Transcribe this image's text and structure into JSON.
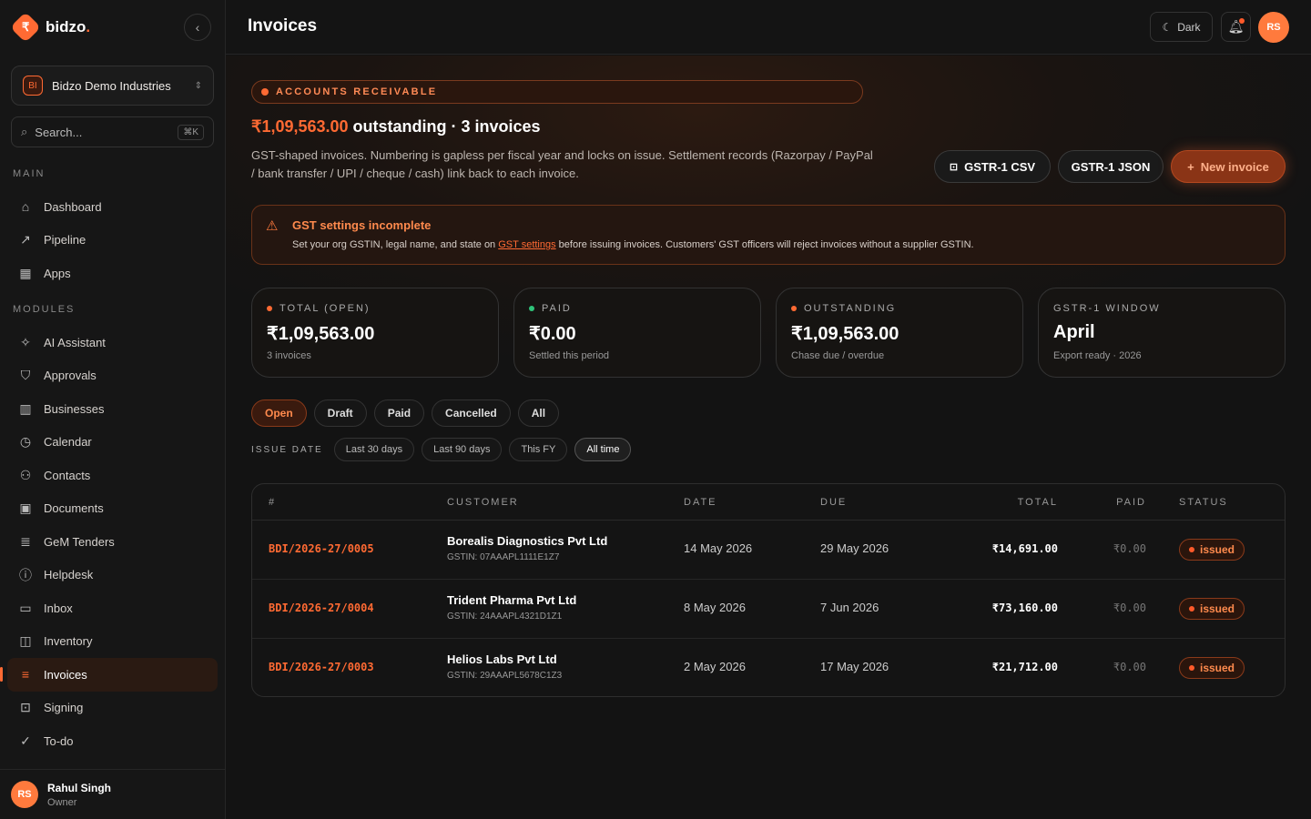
{
  "brand": {
    "name": "bidzo",
    "dot": ".",
    "logo_glyph": "₹"
  },
  "org": {
    "badge": "BI",
    "name": "Bidzo Demo Industries"
  },
  "search": {
    "placeholder": "Search...",
    "shortcut": "⌘K"
  },
  "sidebar": {
    "main_label": "MAIN",
    "main_items": [
      {
        "label": "Dashboard",
        "icon": "home-icon",
        "glyph": "⌂"
      },
      {
        "label": "Pipeline",
        "icon": "trending-icon",
        "glyph": "↗"
      },
      {
        "label": "Apps",
        "icon": "grid-icon",
        "glyph": "▦"
      }
    ],
    "modules_label": "MODULES",
    "module_items": [
      {
        "label": "AI Assistant",
        "icon": "sparkle-icon",
        "glyph": "✧"
      },
      {
        "label": "Approvals",
        "icon": "shield-check-icon",
        "glyph": "⛉"
      },
      {
        "label": "Businesses",
        "icon": "building-icon",
        "glyph": "▥"
      },
      {
        "label": "Calendar",
        "icon": "clock-icon",
        "glyph": "◷"
      },
      {
        "label": "Contacts",
        "icon": "users-icon",
        "glyph": "⚇"
      },
      {
        "label": "Documents",
        "icon": "document-icon",
        "glyph": "▣"
      },
      {
        "label": "GeM Tenders",
        "icon": "list-icon",
        "glyph": "≣"
      },
      {
        "label": "Helpdesk",
        "icon": "info-icon",
        "glyph": "ⓘ"
      },
      {
        "label": "Inbox",
        "icon": "inbox-icon",
        "glyph": "▭"
      },
      {
        "label": "Inventory",
        "icon": "box-icon",
        "glyph": "◫"
      },
      {
        "label": "Invoices",
        "icon": "receipt-icon",
        "glyph": "≡",
        "active": true
      },
      {
        "label": "Signing",
        "icon": "signature-icon",
        "glyph": "⊡"
      },
      {
        "label": "To-do",
        "icon": "check-shield-icon",
        "glyph": "✓"
      }
    ]
  },
  "user": {
    "initials": "RS",
    "name": "Rahul Singh",
    "role": "Owner"
  },
  "header": {
    "title": "Invoices",
    "theme_label": "Dark",
    "theme_icon": "moon-icon",
    "avatar": "RS"
  },
  "hero": {
    "eyebrow": "ACCOUNTS RECEIVABLE",
    "amount": "₹1,09,563.00",
    "headline_rest": " outstanding · 3 invoices",
    "description": "GST-shaped invoices. Numbering is gapless per fiscal year and locks on issue. Settlement records (Razorpay / PayPal / bank transfer / UPI / cheque / cash) link back to each invoice."
  },
  "actions": {
    "csv": "GSTR-1 CSV",
    "json": "GSTR-1 JSON",
    "new": "New invoice"
  },
  "alert": {
    "title": "GST settings incomplete",
    "before": "Set your org GSTIN, legal name, and state on ",
    "link": "GST settings",
    "after": " before issuing invoices. Customers' GST officers will reject invoices without a supplier GSTIN."
  },
  "stats": [
    {
      "label": "TOTAL (OPEN)",
      "value": "₹1,09,563.00",
      "sub": "3 invoices",
      "dot": "#ff6a33"
    },
    {
      "label": "PAID",
      "value": "₹0.00",
      "sub": "Settled this period",
      "dot": "#2fc47a"
    },
    {
      "label": "OUTSTANDING",
      "value": "₹1,09,563.00",
      "sub": "Chase due / overdue",
      "dot": "#ff6a33"
    },
    {
      "label": "GSTR-1 WINDOW",
      "value": "April",
      "sub": "Export ready · 2026",
      "dot": ""
    }
  ],
  "filters": {
    "status": [
      "Open",
      "Draft",
      "Paid",
      "Cancelled",
      "All"
    ],
    "status_active": "Open",
    "date_label": "ISSUE DATE",
    "dates": [
      "Last 30 days",
      "Last 90 days",
      "This FY",
      "All time"
    ],
    "date_active": "All time"
  },
  "table": {
    "headers": {
      "num": "#",
      "customer": "CUSTOMER",
      "date": "DATE",
      "due": "DUE",
      "total": "TOTAL",
      "paid": "PAID",
      "status": "STATUS"
    },
    "rows": [
      {
        "num": "BDI/2026-27/0005",
        "customer": "Borealis Diagnostics Pvt Ltd",
        "gstin": "GSTIN: 07AAAPL1111E1Z7",
        "date": "14 May 2026",
        "due": "29 May 2026",
        "total": "₹14,691.00",
        "paid": "₹0.00",
        "status": "issued"
      },
      {
        "num": "BDI/2026-27/0004",
        "customer": "Trident Pharma Pvt Ltd",
        "gstin": "GSTIN: 24AAAPL4321D1Z1",
        "date": "8 May 2026",
        "due": "7 Jun 2026",
        "total": "₹73,160.00",
        "paid": "₹0.00",
        "status": "issued"
      },
      {
        "num": "BDI/2026-27/0003",
        "customer": "Helios Labs Pvt Ltd",
        "gstin": "GSTIN: 29AAAPL5678C1Z3",
        "date": "2 May 2026",
        "due": "17 May 2026",
        "total": "₹21,712.00",
        "paid": "₹0.00",
        "status": "issued"
      }
    ]
  },
  "colors": {
    "accent": "#ff6a33",
    "background": "#121212",
    "paid_dot": "#2fc47a"
  }
}
